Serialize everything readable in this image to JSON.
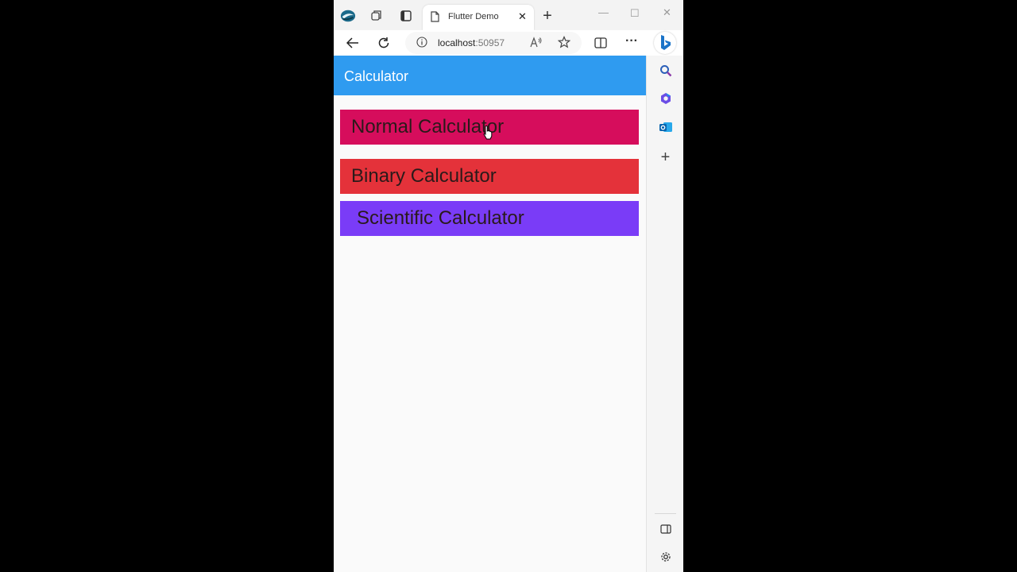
{
  "browser": {
    "tab_title": "Flutter Demo",
    "url_host": "localhost",
    "url_port": ":50957",
    "close_glyph": "✕",
    "new_tab_glyph": "+",
    "minimize_glyph": "—",
    "maximize_glyph": "☐",
    "window_close_glyph": "✕",
    "more_glyph": "···",
    "sidebar_add_glyph": "+"
  },
  "app": {
    "appbar_title": "Calculator",
    "appbar_color": "#2f9bf0",
    "buttons": [
      {
        "label": "Normal Calculator",
        "color": "#d60d5c"
      },
      {
        "label": "Binary Calculator",
        "color": "#e4323a"
      },
      {
        "label": "Scientific Calculator",
        "color": "#7a3cf7"
      }
    ]
  },
  "icons": [
    "browser-logo-icon",
    "collections-icon",
    "tab-actions-icon",
    "page-icon",
    "back-icon",
    "refresh-icon",
    "info-icon",
    "read-aloud-icon",
    "favorite-star-icon",
    "split-screen-icon",
    "more-icon",
    "bing-icon",
    "search-icon",
    "office-icon",
    "outlook-icon",
    "add-icon",
    "sidebar-toggle-icon",
    "settings-icon",
    "mouse-cursor-icon"
  ]
}
